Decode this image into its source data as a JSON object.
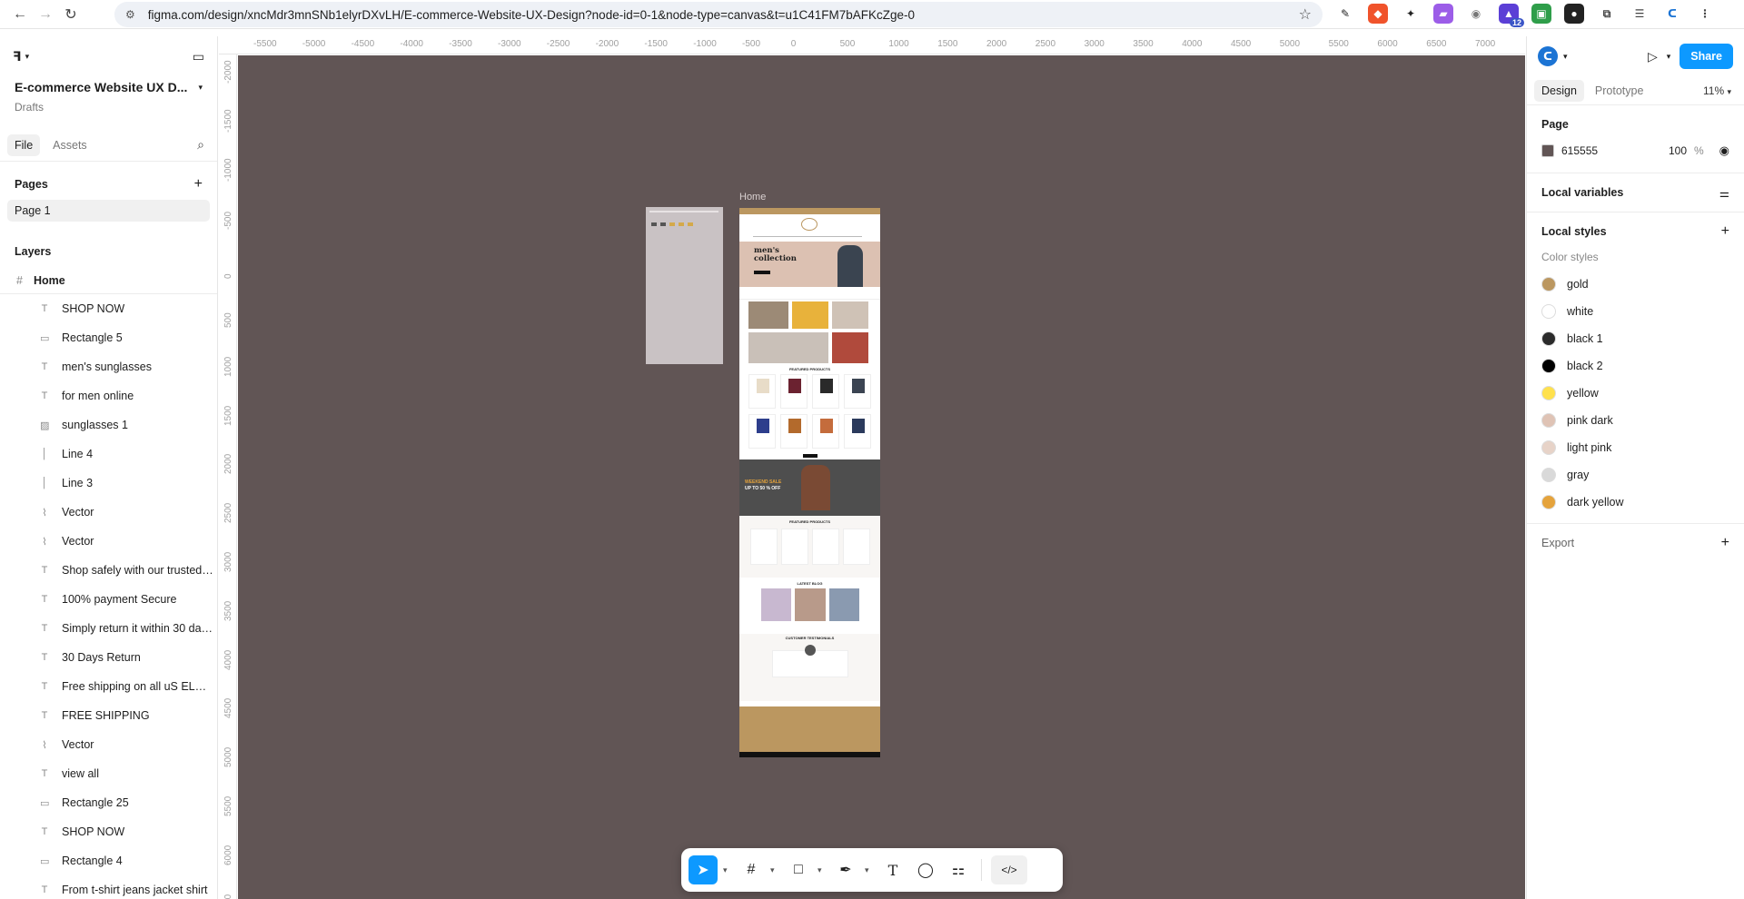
{
  "browser": {
    "url": "figma.com/design/xncMdr3mnSNb1elyrDXvLH/E-commerce-Website-UX-Design?node-id=0-1&node-type=canvas&t=u1C41FM7bAFKcZge-0",
    "notification_count": "12"
  },
  "file": {
    "title": "E-commerce Website UX D...",
    "location": "Drafts",
    "tab_file": "File",
    "tab_assets": "Assets"
  },
  "pages": {
    "heading": "Pages",
    "items": [
      "Page 1"
    ]
  },
  "layers": {
    "heading": "Layers",
    "frame_name": "Home",
    "items": [
      {
        "name": "SHOP NOW",
        "icon": "text-icon"
      },
      {
        "name": "Rectangle 5",
        "icon": "rectangle-icon"
      },
      {
        "name": "men's sunglasses",
        "icon": "text-icon"
      },
      {
        "name": "for men online",
        "icon": "text-icon"
      },
      {
        "name": "sunglasses 1",
        "icon": "image-icon"
      },
      {
        "name": "Line 4",
        "icon": "line-icon"
      },
      {
        "name": "Line 3",
        "icon": "line-icon"
      },
      {
        "name": "Vector",
        "icon": "vector-icon"
      },
      {
        "name": "Vector",
        "icon": "vector-icon"
      },
      {
        "name": "Shop safely with our trusted a...",
        "icon": "text-icon"
      },
      {
        "name": "100% payment Secure",
        "icon": "text-icon"
      },
      {
        "name": "Simply return it within 30 day...",
        "icon": "text-icon"
      },
      {
        "name": "30 Days Return",
        "icon": "text-icon"
      },
      {
        "name": "Free shipping on all uS ELDER...",
        "icon": "text-icon"
      },
      {
        "name": "FREE SHIPPING",
        "icon": "text-icon"
      },
      {
        "name": "Vector",
        "icon": "vector-icon"
      },
      {
        "name": "view all",
        "icon": "text-icon"
      },
      {
        "name": "Rectangle 25",
        "icon": "rectangle-icon"
      },
      {
        "name": "SHOP NOW",
        "icon": "text-icon"
      },
      {
        "name": "Rectangle 4",
        "icon": "rectangle-icon"
      },
      {
        "name": "From t-shirt jeans jacket shirt",
        "icon": "text-icon"
      }
    ]
  },
  "rulers": {
    "top": [
      "-5500",
      "-5000",
      "-4500",
      "-4000",
      "-3500",
      "-3000",
      "-2500",
      "-2000",
      "-1500",
      "-1000",
      "-500",
      "0",
      "500",
      "1000",
      "1500",
      "2000",
      "2500",
      "3000",
      "3500",
      "4000",
      "4500",
      "5000",
      "5500",
      "6000",
      "6500",
      "7000"
    ],
    "left": [
      "-2000",
      "-1500",
      "-1000",
      "-500",
      "0",
      "500",
      "1000",
      "1500",
      "2000",
      "2500",
      "3000",
      "3500",
      "4000",
      "4500",
      "5000",
      "5500",
      "6000",
      "6500"
    ]
  },
  "canvas": {
    "background": "#615555",
    "frame_label": "Home",
    "hero_title": "men's collection",
    "section_featured": "FEATURED PRODUCTS",
    "banner_text": "WEEKEND SALE",
    "banner_sub": "UP TO 50 % OFF",
    "section_latest": "LATEST BLOG",
    "section_testimonial": "CUSTOMER TESTIMONIALS"
  },
  "right_panel": {
    "share_label": "Share",
    "tab_design": "Design",
    "tab_prototype": "Prototype",
    "zoom": "11%",
    "page_heading": "Page",
    "page_fill_hex": "615555",
    "page_fill_opacity": "100",
    "page_fill_unit": "%",
    "local_variables": "Local variables",
    "local_styles": "Local styles",
    "color_styles_heading": "Color styles",
    "color_styles": [
      {
        "name": "gold",
        "color": "#bb9760"
      },
      {
        "name": "white",
        "color": "#ffffff"
      },
      {
        "name": "black 1",
        "color": "#2b2b2b"
      },
      {
        "name": "black 2",
        "color": "#000000"
      },
      {
        "name": "yellow",
        "color": "#ffe14d"
      },
      {
        "name": "pink dark",
        "color": "#dfc3b5"
      },
      {
        "name": "light pink",
        "color": "#e7d3c8"
      },
      {
        "name": "gray",
        "color": "#d9d9d9"
      },
      {
        "name": "dark yellow",
        "color": "#e5a33c"
      }
    ],
    "export_label": "Export"
  },
  "toolbar": {
    "help": "?"
  }
}
